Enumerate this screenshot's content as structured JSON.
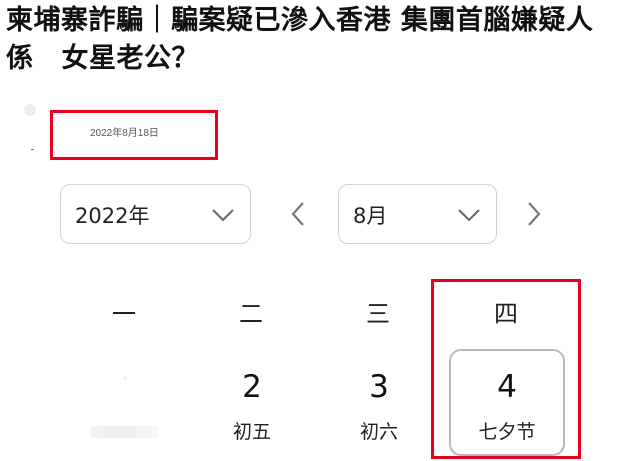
{
  "article": {
    "headline_line1": "柬埔寨詐騙｜騙案疑已滲入香港 集團首腦嫌疑人",
    "headline_line2_a": "係",
    "headline_line2_b": "女星老公？"
  },
  "post": {
    "date": "2022年8月18日"
  },
  "calendar": {
    "year_select": {
      "value": "2022年",
      "icon": "chevron-down-icon"
    },
    "month_select": {
      "value": "8月",
      "icon": "chevron-down-icon"
    },
    "prev_icon": "chevron-left-icon",
    "next_icon": "chevron-right-icon",
    "weekdays": [
      "一",
      "二",
      "三",
      "四"
    ],
    "days": [
      {
        "number": "2",
        "lunar": "初五"
      },
      {
        "number": "3",
        "lunar": "初六"
      },
      {
        "number": "4",
        "lunar": "七夕节",
        "selected": true
      }
    ]
  },
  "annotations": {
    "highlight_color": "#e8001c"
  }
}
